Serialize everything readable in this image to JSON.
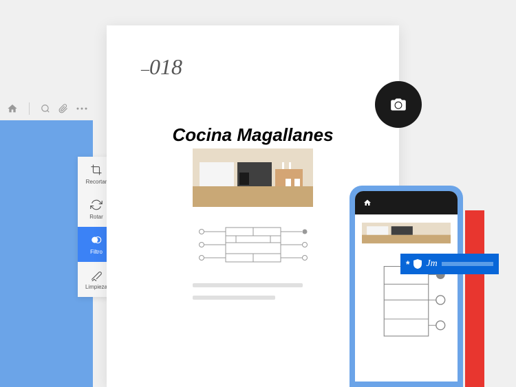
{
  "document": {
    "number": "018",
    "title": "Cocina Magallanes"
  },
  "editPanel": {
    "items": [
      {
        "label": "Recortar",
        "active": false
      },
      {
        "label": "Rotar",
        "active": false
      },
      {
        "label": "Filtro",
        "active": true
      },
      {
        "label": "Limpieza",
        "active": false
      }
    ]
  },
  "signature": {
    "initials": "Jm"
  },
  "colors": {
    "bluePanel": "#6ba4e8",
    "activeBlue": "#3b82f6",
    "red": "#e8362f",
    "signBlue": "#0866d8"
  }
}
